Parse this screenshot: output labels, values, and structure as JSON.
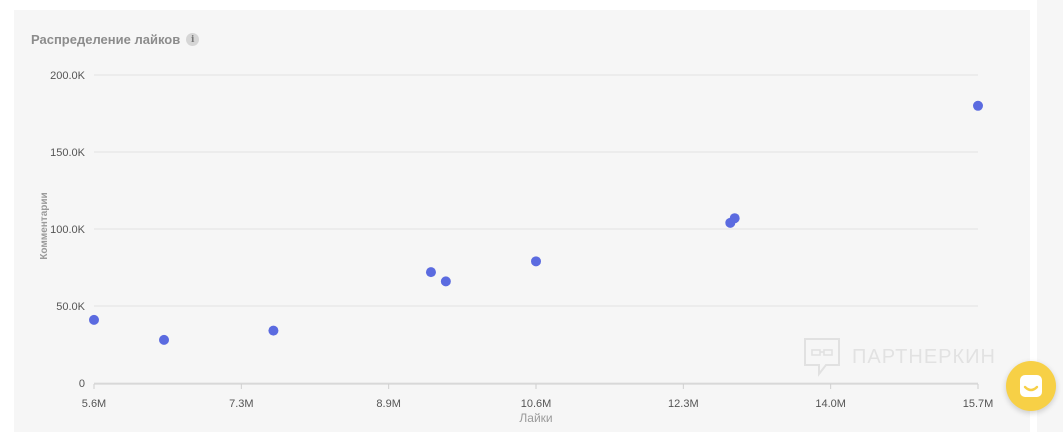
{
  "title": "Распределение лайков",
  "info_icon": "info-icon",
  "watermark": {
    "text": "ПАРТНЕРКИН",
    "icon": "chat-bubble-icon"
  },
  "help_button": {
    "icon": "chat-smile-icon"
  },
  "colors": {
    "point": "#5b6be0",
    "grid": "#e2e2e2",
    "axis_text": "#555555",
    "card_bg": "#f6f6f6",
    "accent_button": "#f7d046"
  },
  "chart_data": {
    "type": "scatter",
    "title": "Распределение лайков",
    "xlabel": "Лайки",
    "ylabel": "Комментарии",
    "xlim": [
      5.6,
      15.7
    ],
    "ylim": [
      0,
      200
    ],
    "x_unit": "M",
    "y_unit": "K",
    "x_ticks": [
      "5.6M",
      "7.3M",
      "8.9M",
      "10.6M",
      "12.3M",
      "14.0M",
      "15.7M"
    ],
    "y_ticks": [
      "0",
      "50.0K",
      "100.0K",
      "150.0K",
      "200.0K"
    ],
    "grid": true,
    "points": [
      {
        "x": 5.6,
        "y": 41
      },
      {
        "x": 6.4,
        "y": 28
      },
      {
        "x": 7.65,
        "y": 34
      },
      {
        "x": 9.45,
        "y": 72
      },
      {
        "x": 9.62,
        "y": 66
      },
      {
        "x": 10.65,
        "y": 79
      },
      {
        "x": 12.87,
        "y": 104
      },
      {
        "x": 12.92,
        "y": 107
      },
      {
        "x": 15.7,
        "y": 180
      }
    ]
  }
}
